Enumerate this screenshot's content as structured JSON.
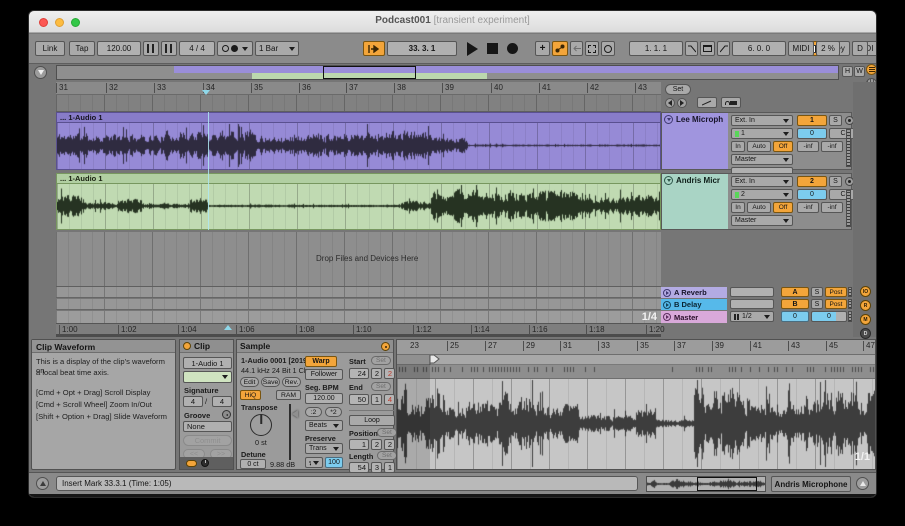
{
  "window": {
    "title": "Podcast001",
    "subtitle": "[transient experiment]"
  },
  "transport": {
    "link": "Link",
    "tap": "Tap",
    "tempo": "120.00",
    "time_sig": "4 / 4",
    "quantize": "1 Bar",
    "position": "33. 3. 1",
    "loop_start": "1. 1. 1",
    "loop_length": "6. 0. 0",
    "key": "Key",
    "midi": "MIDI",
    "cpu": "2 %",
    "overdub": "D"
  },
  "overview": {
    "h_label": "H",
    "w_label": "W"
  },
  "arrangement": {
    "set_label": "Set",
    "bar_ticks": [
      "31",
      "32",
      "33",
      "34",
      "35",
      "36",
      "37",
      "38",
      "39",
      "40",
      "41",
      "42",
      "43"
    ],
    "time_ticks": [
      "1:00",
      "1:02",
      "1:04",
      "1:06",
      "1:08",
      "1:10",
      "1:12",
      "1:14",
      "1:16",
      "1:18",
      "1:20"
    ],
    "drop_hint": "Drop Files and Devices Here",
    "zoom_label": "1/4",
    "tracks": [
      {
        "name": "Lee Microph",
        "clip_label": "... 1-Audio 1",
        "input_type": "Ext. In",
        "input_channel": "1",
        "monitor_in": "In",
        "monitor_auto": "Auto",
        "monitor_off": "Off",
        "output": "Master",
        "arm": "1",
        "solo": "S",
        "pan": "C",
        "volume": "0",
        "meter_l": "-inf",
        "meter_r": "-inf"
      },
      {
        "name": "Andris Micr",
        "clip_label": "... 1-Audio 1",
        "input_type": "Ext. In",
        "input_channel": "2",
        "monitor_in": "In",
        "monitor_auto": "Auto",
        "monitor_off": "Off",
        "output": "Master",
        "arm": "2",
        "solo": "S",
        "pan": "C",
        "volume": "0",
        "meter_l": "-inf",
        "meter_r": "-inf"
      }
    ],
    "returns": [
      {
        "name": "A Reverb",
        "send": "A",
        "solo": "S",
        "mode": "Post"
      },
      {
        "name": "B Delay",
        "send": "B",
        "solo": "S",
        "mode": "Post"
      }
    ],
    "master": {
      "name": "Master",
      "quantize": "1/2",
      "pan": "0",
      "volume": "0"
    }
  },
  "info_panel": {
    "title": "Clip Waveform",
    "line1": "This is a display of the clip's waveform on",
    "line2": "a local beat time axis.",
    "shortcut1": "[Cmd + Opt + Drag] Scroll Display",
    "shortcut2": "[Cmd + Scroll Wheel] Zoom In/Out",
    "shortcut3": "[Shift + Option + Drag] Slide Waveform"
  },
  "clip_panel": {
    "title": "Clip",
    "name": "1-Audio 1",
    "signature_label": "Signature",
    "sig_num": "4",
    "sig_sep": "/",
    "sig_den": "4",
    "groove_label": "Groove",
    "groove_value": "None",
    "commit": "Commit",
    "prev": "<<",
    "next": ">>"
  },
  "sample_panel": {
    "title": "Sample",
    "file_name": "1-Audio 0001 [2019",
    "file_format": "44.1 kHz 24 Bit 1 Ch",
    "edit": "Edit",
    "save": "Save",
    "rev": "Rev.",
    "hiq": "HiQ",
    "ram": "RAM",
    "transpose_label": "Transpose",
    "transpose_value": "0 st",
    "detune_label": "Detune",
    "detune_value": "0 ct",
    "gain_value": "9.88 dB",
    "warp": "Warp",
    "follower": "Follower",
    "seg_bpm_label": "Seg. BPM",
    "seg_bpm": "120.00",
    "half": ":2",
    "double": "*2",
    "warp_mode": "Beats",
    "preserve_label": "Preserve",
    "preserve_value": "Trans",
    "transient_value": "100"
  },
  "loop_section": {
    "set": "Set",
    "start_label": "Start",
    "end_label": "End",
    "loop": "Loop",
    "position_label": "Position",
    "length_label": "Length",
    "start": [
      "24",
      "2",
      "2"
    ],
    "end": [
      "50",
      "1",
      "4"
    ],
    "position": [
      "1",
      "2",
      "2"
    ],
    "length": [
      "54",
      "3",
      "1"
    ]
  },
  "clip_view": {
    "bar_ticks": [
      "23",
      "25",
      "27",
      "29",
      "31",
      "33",
      "35",
      "37",
      "39",
      "41",
      "43",
      "45",
      "47"
    ],
    "zoom_label": "1/1"
  },
  "status_bar": {
    "message": "Insert Mark 33.3.1 (Time: 1:05)",
    "clip_selector": "Andris Microphone"
  },
  "colors": {
    "accent_orange": "#f3a53a",
    "value_blue": "#7cccee",
    "clip_purple": "#968ad6",
    "clip_green": "#c0dab2",
    "header_purple": "#a095de",
    "header_teal": "#a9d4c5",
    "return_a": "#b3abe3",
    "return_b": "#56b9ea",
    "master_pink": "#d9a9da"
  },
  "waveforms": {
    "lee": [
      [
        0,
        0.05,
        0.62
      ],
      [
        0.05,
        0.18,
        0.55
      ],
      [
        0.18,
        0.27,
        0.7
      ],
      [
        0.27,
        0.33,
        0.85
      ],
      [
        0.33,
        0.42,
        0.5
      ],
      [
        0.42,
        0.5,
        0.65
      ],
      [
        0.5,
        0.62,
        0.72
      ],
      [
        0.62,
        0.68,
        0.4
      ],
      [
        0.68,
        1,
        0.05
      ]
    ],
    "andris": [
      [
        0,
        0.04,
        0.55
      ],
      [
        0.04,
        0.1,
        0.2
      ],
      [
        0.1,
        0.14,
        0.4
      ],
      [
        0.14,
        0.22,
        0.12
      ],
      [
        0.22,
        0.25,
        0.45
      ],
      [
        0.25,
        0.57,
        0.07
      ],
      [
        0.57,
        0.62,
        0.25
      ],
      [
        0.62,
        0.88,
        0.78
      ],
      [
        0.88,
        0.95,
        0.45
      ],
      [
        0.95,
        1,
        0.6
      ]
    ],
    "editor": [
      [
        0,
        0.02,
        0.95
      ],
      [
        0.02,
        0.06,
        0.5
      ],
      [
        0.06,
        0.1,
        0.85
      ],
      [
        0.1,
        0.22,
        0.55
      ],
      [
        0.22,
        0.3,
        0.72
      ],
      [
        0.3,
        0.38,
        0.45
      ],
      [
        0.38,
        0.5,
        0.2
      ],
      [
        0.5,
        0.54,
        0.38
      ],
      [
        0.54,
        0.62,
        0.1
      ],
      [
        0.62,
        0.72,
        0.9
      ],
      [
        0.72,
        0.8,
        0.6
      ],
      [
        0.8,
        0.88,
        0.5
      ],
      [
        0.88,
        1,
        0.82
      ]
    ],
    "mini": [
      [
        0,
        0.08,
        0.7
      ],
      [
        0.08,
        0.18,
        0.2
      ],
      [
        0.18,
        0.3,
        0.6
      ],
      [
        0.3,
        0.45,
        0.5
      ],
      [
        0.45,
        0.55,
        0.3
      ],
      [
        0.55,
        0.75,
        0.7
      ],
      [
        0.75,
        0.85,
        0.4
      ],
      [
        0.85,
        1,
        0.6
      ]
    ]
  }
}
